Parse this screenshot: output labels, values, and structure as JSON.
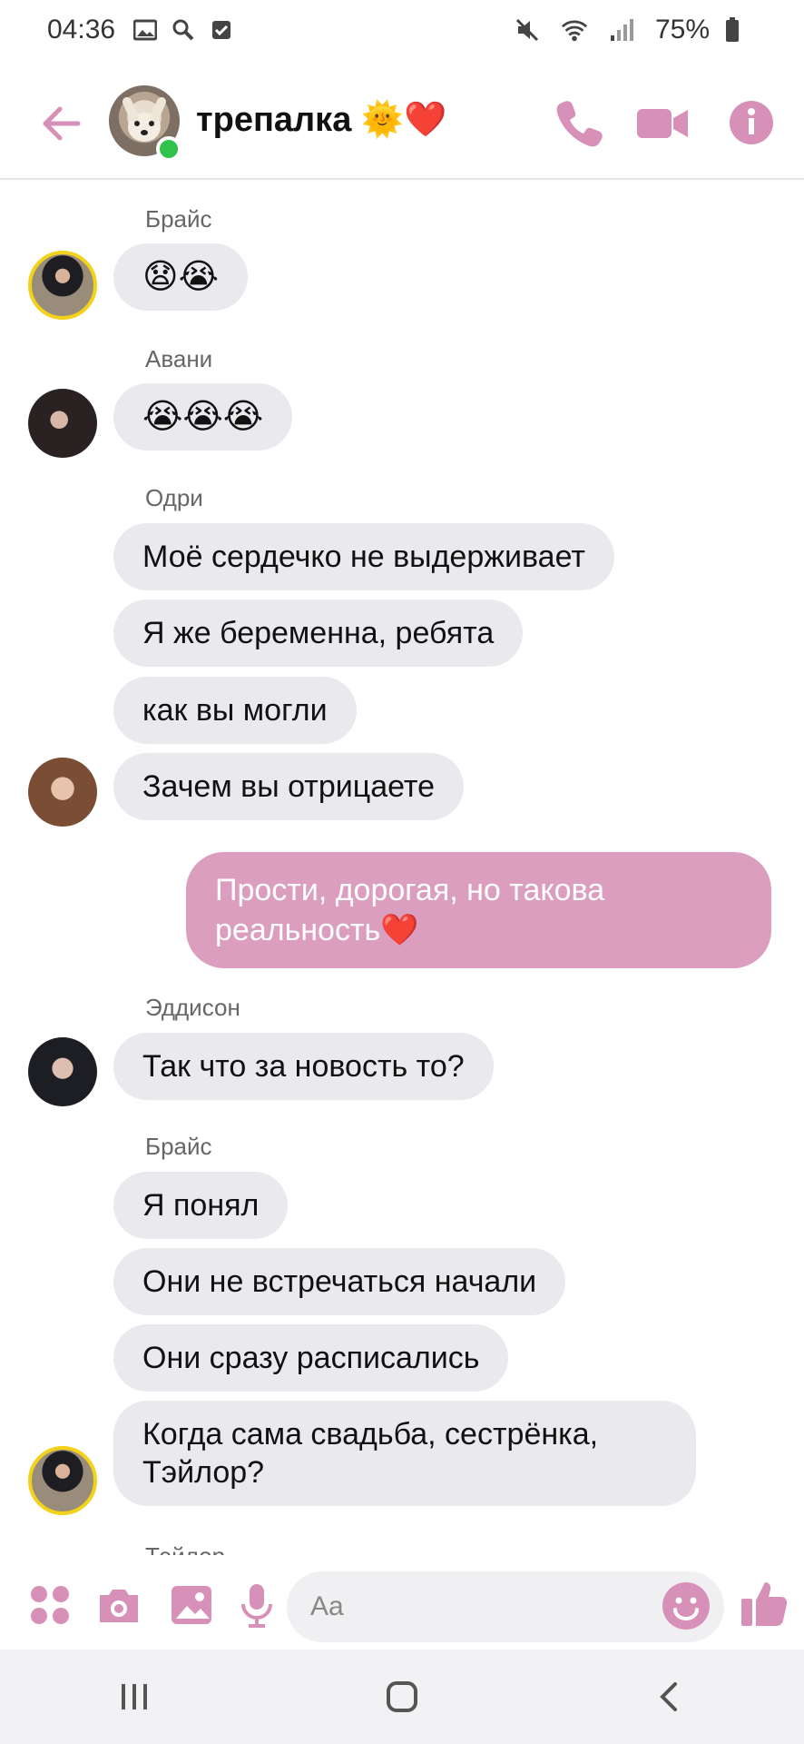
{
  "status_bar": {
    "time": "04:36",
    "battery": "75%"
  },
  "header": {
    "title": "трепалка 🌞❤️"
  },
  "colors": {
    "accent": "#dc9ebf",
    "icon": "#d791b9",
    "bubble_in": "#eaeaee",
    "online": "#31c24b"
  },
  "icons": {
    "back": "arrow-left-icon",
    "call": "phone-icon",
    "video": "video-icon",
    "info": "info-icon",
    "apps": "apps-icon",
    "camera": "camera-icon",
    "gallery": "image-icon",
    "mic": "microphone-icon",
    "emoji": "emoji-icon",
    "like": "thumbs-up-icon"
  },
  "messages": {
    "g1": {
      "sender": "Брайс",
      "m1": "😧😭"
    },
    "g2": {
      "sender": "Авани",
      "m1": "😭😭😭"
    },
    "g3": {
      "sender": "Одри",
      "m1": "Моё сердечко не выдерживает",
      "m2": "Я же беременна, ребята",
      "m3": "как вы могли",
      "m4": "Зачем вы отрицаете"
    },
    "out1": "Прости, дорогая, но такова реальность❤️",
    "g4": {
      "sender": "Эддисон",
      "m1": "Так что за новость то?"
    },
    "g5": {
      "sender": "Брайс",
      "m1": "Я понял",
      "m2": "Они не встречаться начали",
      "m3": "Они сразу расписались",
      "m4": "Когда сама свадьба, сестрёнка, Тэйлор?"
    },
    "g6": {
      "sender": "Тэйлор"
    }
  },
  "composer": {
    "placeholder": "Aa"
  }
}
